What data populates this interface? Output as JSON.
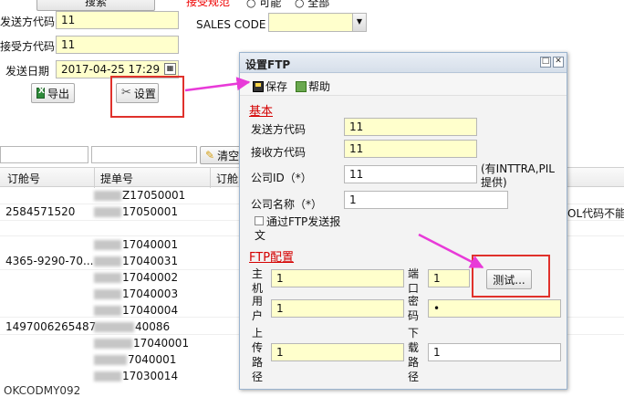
{
  "top": {
    "partial_button_label": "搜索",
    "partial_red_text": "接受规范",
    "radio_a": "可能",
    "radio_b": "全部"
  },
  "form": {
    "sender_code_label": "发送方代码",
    "sender_code_value": "11",
    "receiver_code_label": "接受方代码",
    "receiver_code_value": "11",
    "send_date_label": "发送日期",
    "send_date_value": "2017-04-25 17:29",
    "sales_code_label": "SALES CODE",
    "sales_code_value": "",
    "export_button": "导出",
    "settings_button": "设置"
  },
  "filter_bar": {
    "clear_button": "清空"
  },
  "grid": {
    "columns": [
      "订舱号",
      "提单号",
      "订舱"
    ],
    "rows": [
      {
        "booking": "",
        "bl_suffix": "Z17050001"
      },
      {
        "booking": "2584571520",
        "bl_suffix": "17050001"
      },
      {
        "booking": "",
        "bl_suffix": ""
      },
      {
        "booking": "",
        "bl_suffix": "17040001"
      },
      {
        "booking": "4365-9290-70...",
        "bl_suffix": "17040031"
      },
      {
        "booking": "",
        "bl_suffix": "17040002"
      },
      {
        "booking": "",
        "bl_suffix": "17040003"
      },
      {
        "booking": "",
        "bl_suffix": "17040004"
      },
      {
        "booking": "1497006265487",
        "bl_suffix": "40086"
      },
      {
        "booking": "",
        "bl_suffix": "17040001"
      },
      {
        "booking": "",
        "bl_suffix": "7040001"
      },
      {
        "booking": "",
        "bl_suffix": "17030014"
      }
    ],
    "right_overflow_text": "OL代码不能",
    "bottom_row_partial": "OKCODMY092"
  },
  "dialog": {
    "title": "设置FTP",
    "save": "保存",
    "help": "帮助",
    "section_basic": "基本",
    "sender_label": "发送方代码",
    "sender_value": "11",
    "receiver_label": "接收方代码",
    "receiver_value": "11",
    "company_id_label": "公司ID（*）",
    "company_id_value": "11",
    "company_id_hint": "(有INTTRA,PIL提供)",
    "company_name_label": "公司名称（*）",
    "company_name_value": "1",
    "ftp_checkbox_label": "通过FTP发送报文",
    "section_ftp": "FTP配置",
    "host_label": "主机",
    "host_value": "1",
    "port_label": "端口",
    "port_value": "1",
    "test_button": "测试...",
    "user_label": "用户",
    "user_value": "1",
    "password_label": "密码",
    "password_value": "•",
    "upload_label": "上传路径",
    "upload_value": "1",
    "download_label": "下载路径",
    "download_value": "1"
  },
  "colors": {
    "field_bg": "#ffffcc",
    "annotation_red": "#e0312b",
    "arrow_magenta": "#e83ad8",
    "section_red": "#d40000"
  }
}
